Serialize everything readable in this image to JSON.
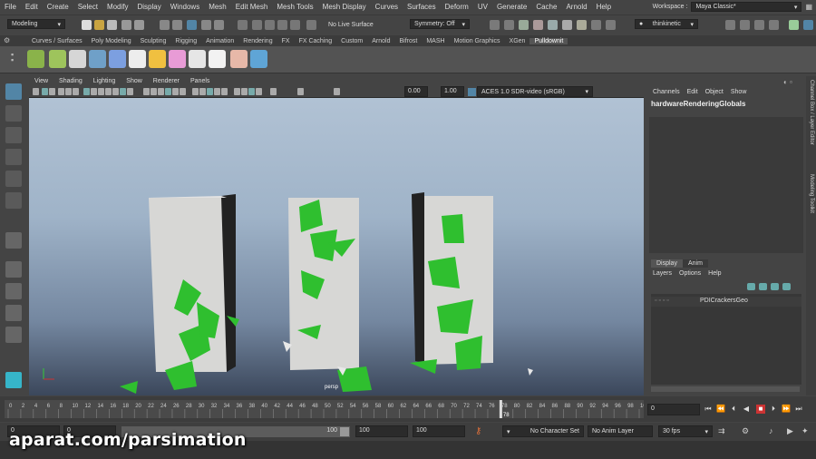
{
  "menubar": {
    "items": [
      "File",
      "Edit",
      "Create",
      "Select",
      "Modify",
      "Display",
      "Windows",
      "Mesh",
      "Edit Mesh",
      "Mesh Tools",
      "Mesh Display",
      "Curves",
      "Surfaces",
      "Deform",
      "UV",
      "Generate",
      "Cache",
      "Arnold",
      "Help"
    ],
    "workspace_label": "Workspace :",
    "workspace_value": "Maya Classic*"
  },
  "statusline": {
    "mode": "Modeling",
    "live_surface": "No Live Surface",
    "symmetry": "Symmetry: Off",
    "user": "thinkinetic"
  },
  "shelf": {
    "tabs": [
      "Curves / Surfaces",
      "Poly Modeling",
      "Sculpting",
      "Rigging",
      "Animation",
      "Rendering",
      "FX",
      "FX Caching",
      "Custom",
      "Arnold",
      "Bifrost",
      "MASH",
      "Motion Graphics",
      "XGen",
      "Pulldownit"
    ],
    "active_tab": "Pulldownit"
  },
  "viewport": {
    "menus": [
      "View",
      "Shading",
      "Lighting",
      "Show",
      "Renderer",
      "Panels"
    ],
    "exposure": "0.00",
    "gamma": "1.00",
    "colorspace": "ACES 1.0 SDR-video (sRGB)",
    "camera_label": "persp"
  },
  "channel_box": {
    "menus": [
      "Channels",
      "Edit",
      "Object",
      "Show"
    ],
    "node_name": "hardwareRenderingGlobals"
  },
  "layer_editor": {
    "tabs": [
      "Display",
      "Anim"
    ],
    "active_tab": "Display",
    "menus": [
      "Layers",
      "Options",
      "Help"
    ],
    "layer_name": "PDICrackersGeo"
  },
  "side_tabs": {
    "channel_box_label": "Channel Box / Layer Editor",
    "modeling_toolkit_label": "Modeling Toolkit"
  },
  "timeline": {
    "ticks": [
      "0",
      "2",
      "4",
      "6",
      "8",
      "10",
      "12",
      "14",
      "16",
      "18",
      "20",
      "22",
      "24",
      "26",
      "28",
      "30",
      "32",
      "34",
      "36",
      "38",
      "40",
      "42",
      "44",
      "46",
      "48",
      "50",
      "52",
      "54",
      "56",
      "58",
      "60",
      "62",
      "64",
      "66",
      "68",
      "70",
      "72",
      "74",
      "76",
      "78",
      "80",
      "82",
      "84",
      "86",
      "88",
      "90",
      "92",
      "94",
      "96",
      "98",
      "100"
    ],
    "current_frame": "78",
    "end_frame_field": "0"
  },
  "range": {
    "start": "0",
    "playback_start": "0",
    "playback_end": "100",
    "end": "100",
    "end2": "100",
    "character_set": "No Character Set",
    "anim_layer": "No Anim Layer",
    "fps": "30 fps"
  },
  "watermark": "aparat.com/parsimation",
  "colors": {
    "ui_bg": "#444444",
    "highlight": "#5285a6",
    "pillar": "#d7d7d5",
    "ivy": "#33cc33",
    "playhead": "#cc3333"
  }
}
